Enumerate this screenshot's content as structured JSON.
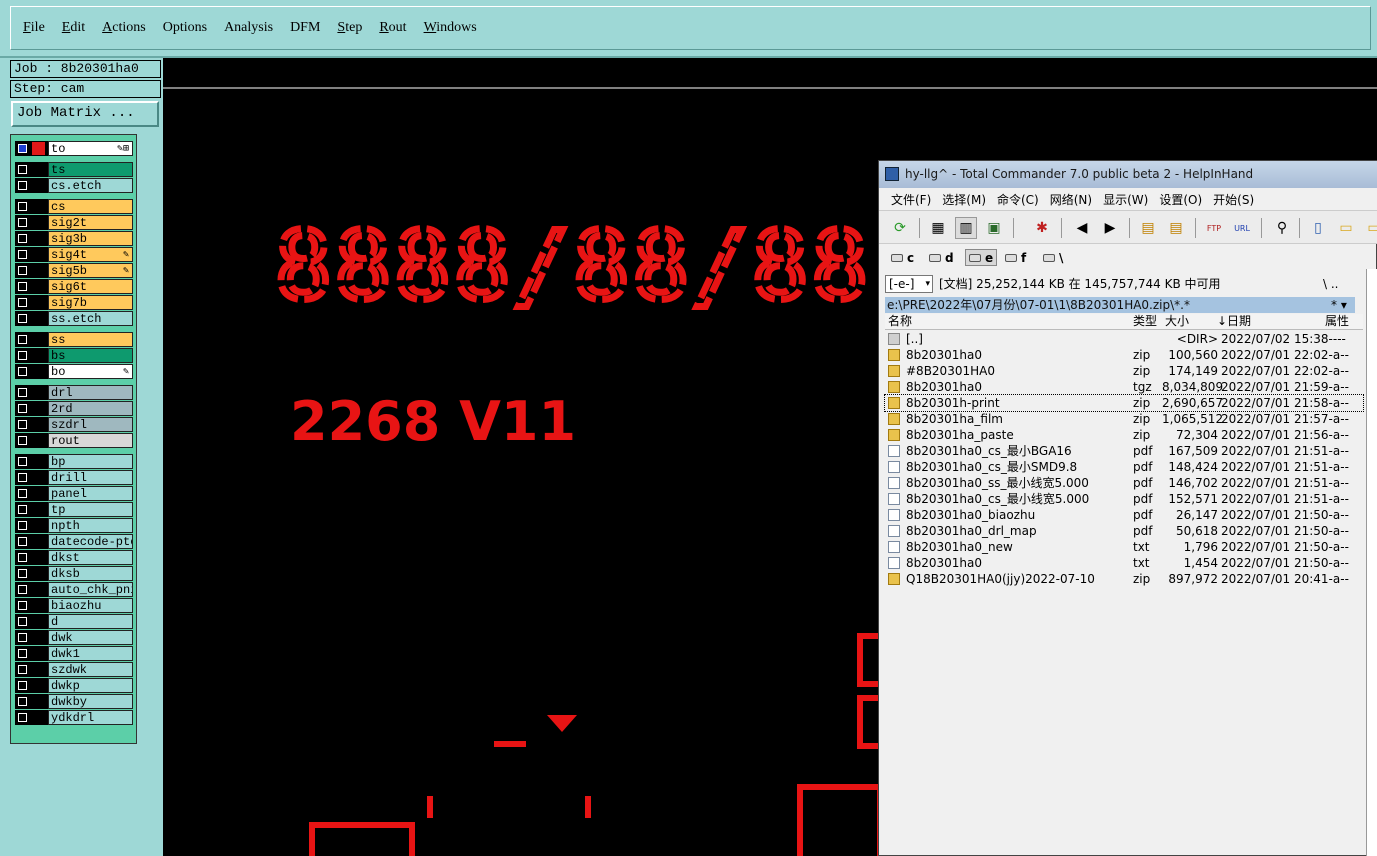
{
  "menubar": {
    "items": [
      {
        "label": "File",
        "ul": true
      },
      {
        "label": "Edit",
        "ul": true
      },
      {
        "label": "Actions",
        "ul": true
      },
      {
        "label": "Options",
        "ul": false
      },
      {
        "label": "Analysis",
        "ul": false
      },
      {
        "label": "DFM",
        "ul": false
      },
      {
        "label": "Step",
        "ul": true
      },
      {
        "label": "Rout",
        "ul": true
      },
      {
        "label": "Windows",
        "ul": true
      }
    ]
  },
  "job": {
    "job_label": "Job : 8b20301ha0",
    "step_label": "Step: cam",
    "matrix_button": "Job Matrix ..."
  },
  "layers": [
    {
      "name": "to",
      "color": "#ffffff",
      "flag": "✎⊞",
      "checked_blue": true,
      "red": true
    },
    {
      "name": "ts",
      "color": "#0e9a6e",
      "flag": "",
      "checked_blue": false,
      "red": false
    },
    {
      "name": "cs.etch",
      "color": "#9ed8d6",
      "flag": "",
      "checked_blue": false,
      "red": false
    },
    {
      "name": "cs",
      "color": "#ffc95c",
      "flag": "",
      "checked_blue": false,
      "red": false
    },
    {
      "name": "sig2t",
      "color": "#ffc95c",
      "flag": "",
      "checked_blue": false,
      "red": false
    },
    {
      "name": "sig3b",
      "color": "#ffc95c",
      "flag": "",
      "checked_blue": false,
      "red": false
    },
    {
      "name": "sig4t",
      "color": "#ffc95c",
      "flag": "✎",
      "checked_blue": false,
      "red": false
    },
    {
      "name": "sig5b",
      "color": "#ffc95c",
      "flag": "✎",
      "checked_blue": false,
      "red": false
    },
    {
      "name": "sig6t",
      "color": "#ffc95c",
      "flag": "",
      "checked_blue": false,
      "red": false
    },
    {
      "name": "sig7b",
      "color": "#ffc95c",
      "flag": "",
      "checked_blue": false,
      "red": false
    },
    {
      "name": "ss.etch",
      "color": "#9ed8d6",
      "flag": "",
      "checked_blue": false,
      "red": false
    },
    {
      "name": "ss",
      "color": "#ffc95c",
      "flag": "",
      "checked_blue": false,
      "red": false
    },
    {
      "name": "bs",
      "color": "#0e9a6e",
      "flag": "",
      "checked_blue": false,
      "red": false
    },
    {
      "name": "bo",
      "color": "#ffffff",
      "flag": "✎",
      "checked_blue": false,
      "red": false
    },
    {
      "name": "drl",
      "color": "#9fb8bf",
      "flag": "",
      "checked_blue": false,
      "red": false
    },
    {
      "name": "2rd",
      "color": "#9fb8bf",
      "flag": "",
      "checked_blue": false,
      "red": false
    },
    {
      "name": "szdrl",
      "color": "#9fb8bf",
      "flag": "",
      "checked_blue": false,
      "red": false
    },
    {
      "name": "rout",
      "color": "#d8d8d8",
      "flag": "",
      "checked_blue": false,
      "red": false
    },
    {
      "name": "bp",
      "color": "#9ed8d6",
      "flag": "",
      "checked_blue": false,
      "red": false
    },
    {
      "name": "drill",
      "color": "#9ed8d6",
      "flag": "",
      "checked_blue": false,
      "red": false
    },
    {
      "name": "panel",
      "color": "#9ed8d6",
      "flag": "",
      "checked_blue": false,
      "red": false
    },
    {
      "name": "tp",
      "color": "#9ed8d6",
      "flag": "",
      "checked_blue": false,
      "red": false
    },
    {
      "name": "npth",
      "color": "#9ed8d6",
      "flag": "",
      "checked_blue": false,
      "red": false
    },
    {
      "name": "datecode-pte",
      "color": "#9ed8d6",
      "flag": "",
      "checked_blue": false,
      "red": false
    },
    {
      "name": "dkst",
      "color": "#9ed8d6",
      "flag": "",
      "checked_blue": false,
      "red": false
    },
    {
      "name": "dksb",
      "color": "#9ed8d6",
      "flag": "",
      "checked_blue": false,
      "red": false
    },
    {
      "name": "auto_chk_pni",
      "color": "#9ed8d6",
      "flag": "",
      "checked_blue": false,
      "red": false
    },
    {
      "name": "biaozhu",
      "color": "#9ed8d6",
      "flag": "",
      "checked_blue": false,
      "red": false
    },
    {
      "name": "d",
      "color": "#9ed8d6",
      "flag": "",
      "checked_blue": false,
      "red": false
    },
    {
      "name": "dwk",
      "color": "#9ed8d6",
      "flag": "",
      "checked_blue": false,
      "red": false
    },
    {
      "name": "dwk1",
      "color": "#9ed8d6",
      "flag": "",
      "checked_blue": false,
      "red": false
    },
    {
      "name": "szdwk",
      "color": "#9ed8d6",
      "flag": "",
      "checked_blue": false,
      "red": false
    },
    {
      "name": "dwkp",
      "color": "#9ed8d6",
      "flag": "",
      "checked_blue": false,
      "red": false
    },
    {
      "name": "dwkby",
      "color": "#9ed8d6",
      "flag": "",
      "checked_blue": false,
      "red": false
    },
    {
      "name": "ydkdrl",
      "color": "#9ed8d6",
      "flag": "",
      "checked_blue": false,
      "red": false
    }
  ],
  "canvas": {
    "date_text": "8888/88/88",
    "version_text": "2268 V11",
    "draw_color": "#e81414"
  },
  "tc": {
    "title": "hy-llg^ - Total Commander 7.0 public beta 2 - HelpInHand",
    "menu": [
      "文件(F)",
      "选择(M)",
      "命令(C)",
      "网络(N)",
      "显示(W)",
      "设置(O)",
      "开始(S)"
    ],
    "drives": [
      "c",
      "d",
      "e",
      "f",
      "\\"
    ],
    "drive_select": "[-e-]",
    "free_text": "[文档]  25,252,144 KB 在 145,757,744 KB 中可用",
    "free_right": "\\  ..",
    "path": "e:\\PRE\\2022年\\07月份\\07-01\\1\\8B20301HA0.zip\\*.*",
    "path_right": "*  ▾",
    "columns": {
      "name": "名称",
      "type": "类型",
      "size": "大小",
      "date": "↓日期",
      "attr": "属性"
    },
    "files": [
      {
        "icon": "up",
        "name": "[..]",
        "type": "",
        "size": "<DIR>",
        "date": "2022/07/02 15:38----"
      },
      {
        "icon": "zip",
        "name": "8b20301ha0",
        "type": "zip",
        "size": "100,560",
        "date": "2022/07/01 22:02-a--"
      },
      {
        "icon": "zip",
        "name": "#8B20301HA0",
        "type": "zip",
        "size": "174,149",
        "date": "2022/07/01 22:02-a--"
      },
      {
        "icon": "zip",
        "name": "8b20301ha0",
        "type": "tgz",
        "size": "8,034,809",
        "date": "2022/07/01 21:59-a--"
      },
      {
        "icon": "zip",
        "name": "8b20301h-print",
        "type": "zip",
        "size": "2,690,657",
        "date": "2022/07/01 21:58-a--"
      },
      {
        "icon": "zip",
        "name": "8b20301ha_film",
        "type": "zip",
        "size": "1,065,512",
        "date": "2022/07/01 21:57-a--"
      },
      {
        "icon": "zip",
        "name": "8b20301ha_paste",
        "type": "zip",
        "size": "72,304",
        "date": "2022/07/01 21:56-a--"
      },
      {
        "icon": "pdf",
        "name": "8b20301ha0_cs_最小BGA16",
        "type": "pdf",
        "size": "167,509",
        "date": "2022/07/01 21:51-a--"
      },
      {
        "icon": "pdf",
        "name": "8b20301ha0_cs_最小SMD9.8",
        "type": "pdf",
        "size": "148,424",
        "date": "2022/07/01 21:51-a--"
      },
      {
        "icon": "pdf",
        "name": "8b20301ha0_ss_最小线宽5.000",
        "type": "pdf",
        "size": "146,702",
        "date": "2022/07/01 21:51-a--"
      },
      {
        "icon": "pdf",
        "name": "8b20301ha0_cs_最小线宽5.000",
        "type": "pdf",
        "size": "152,571",
        "date": "2022/07/01 21:51-a--"
      },
      {
        "icon": "pdf",
        "name": "8b20301ha0_biaozhu",
        "type": "pdf",
        "size": "26,147",
        "date": "2022/07/01 21:50-a--"
      },
      {
        "icon": "pdf",
        "name": "8b20301ha0_drl_map",
        "type": "pdf",
        "size": "50,618",
        "date": "2022/07/01 21:50-a--"
      },
      {
        "icon": "txt",
        "name": "8b20301ha0_new",
        "type": "txt",
        "size": "1,796",
        "date": "2022/07/01 21:50-a--"
      },
      {
        "icon": "txt",
        "name": "8b20301ha0",
        "type": "txt",
        "size": "1,454",
        "date": "2022/07/01 21:50-a--"
      },
      {
        "icon": "zip",
        "name": "Q18B20301HA0(jjy)2022-07-10",
        "type": "zip",
        "size": "897,972",
        "date": "2022/07/01 20:41-a--"
      }
    ],
    "selected_index": 4
  }
}
